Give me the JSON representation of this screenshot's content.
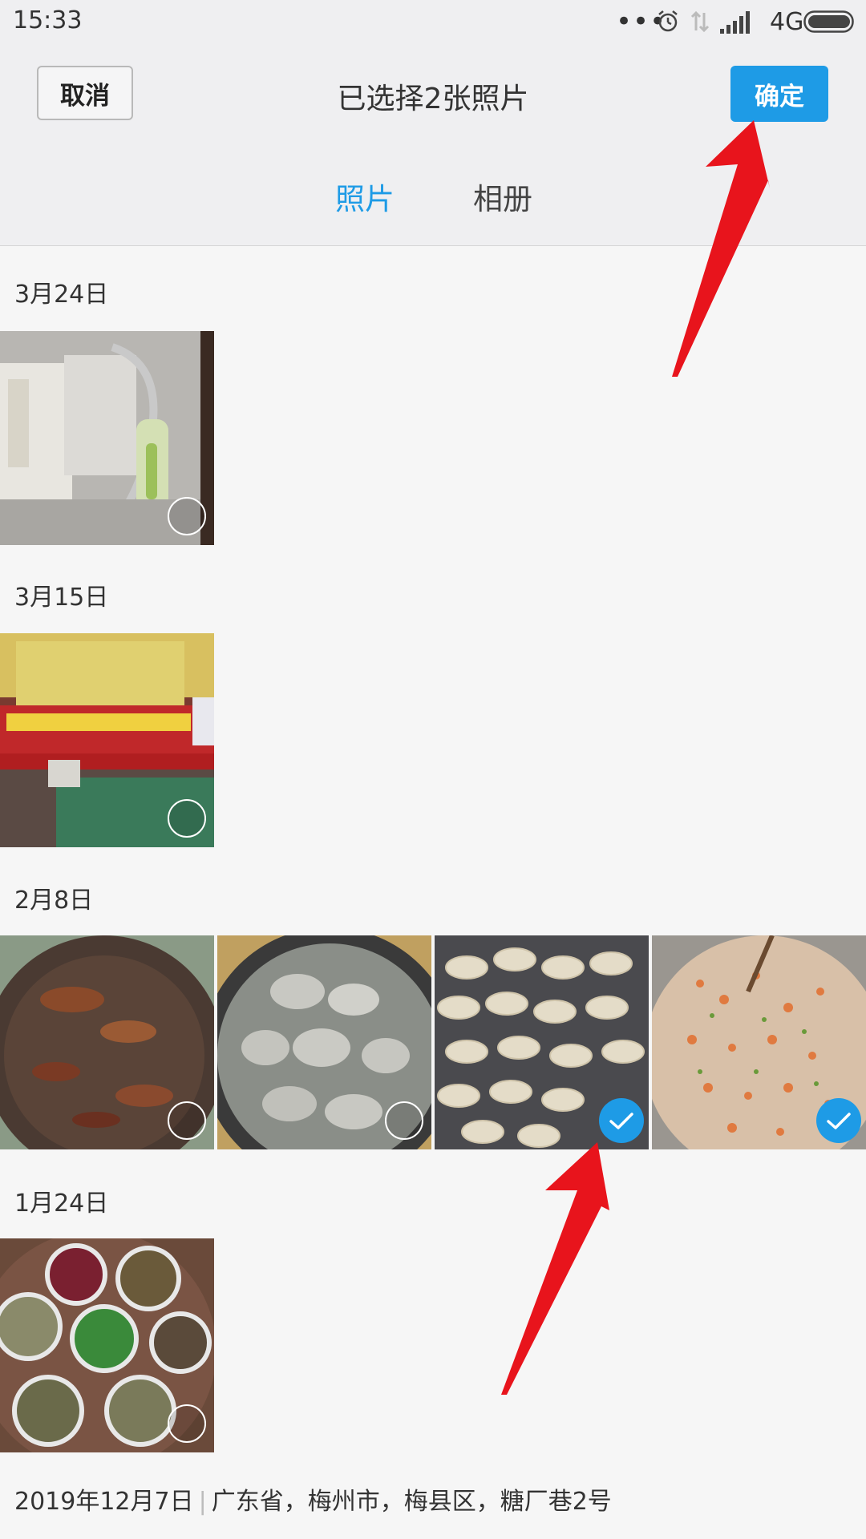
{
  "status_bar": {
    "time": "15:33",
    "dots": "•••",
    "network": "4G",
    "icons": [
      "more-dots-icon",
      "alarm-icon",
      "data-transfer-icon",
      "signal-icon",
      "battery-icon"
    ]
  },
  "header": {
    "cancel_label": "取消",
    "title": "已选择2张照片",
    "confirm_label": "确定",
    "tabs": [
      {
        "label": "照片",
        "active": true
      },
      {
        "label": "相册",
        "active": false
      }
    ]
  },
  "sections": [
    {
      "date": "3月24日",
      "photos": [
        {
          "subject": "charger-and-manual",
          "selected": false
        }
      ]
    },
    {
      "date": "3月15日",
      "photos": [
        {
          "subject": "motorcycle-school-storefront",
          "selected": false
        }
      ]
    },
    {
      "date": "2月8日",
      "photos": [
        {
          "subject": "braised-meat-pot",
          "selected": false
        },
        {
          "subject": "boiled-dumplings",
          "selected": false
        },
        {
          "subject": "raw-dumplings",
          "selected": true
        },
        {
          "subject": "dumpling-filling",
          "selected": true
        }
      ]
    },
    {
      "date": "1月24日",
      "photos": [
        {
          "subject": "dinner-table-dishes",
          "selected": false
        }
      ]
    }
  ],
  "footer": {
    "date": "2019年12月7日",
    "location": "广东省，梅州市，梅县区，糖厂巷2号"
  },
  "colors": {
    "accent": "#1e9be6",
    "arrow": "#e8141c",
    "header_bg": "#efeff1",
    "page_bg": "#f6f6f6"
  }
}
